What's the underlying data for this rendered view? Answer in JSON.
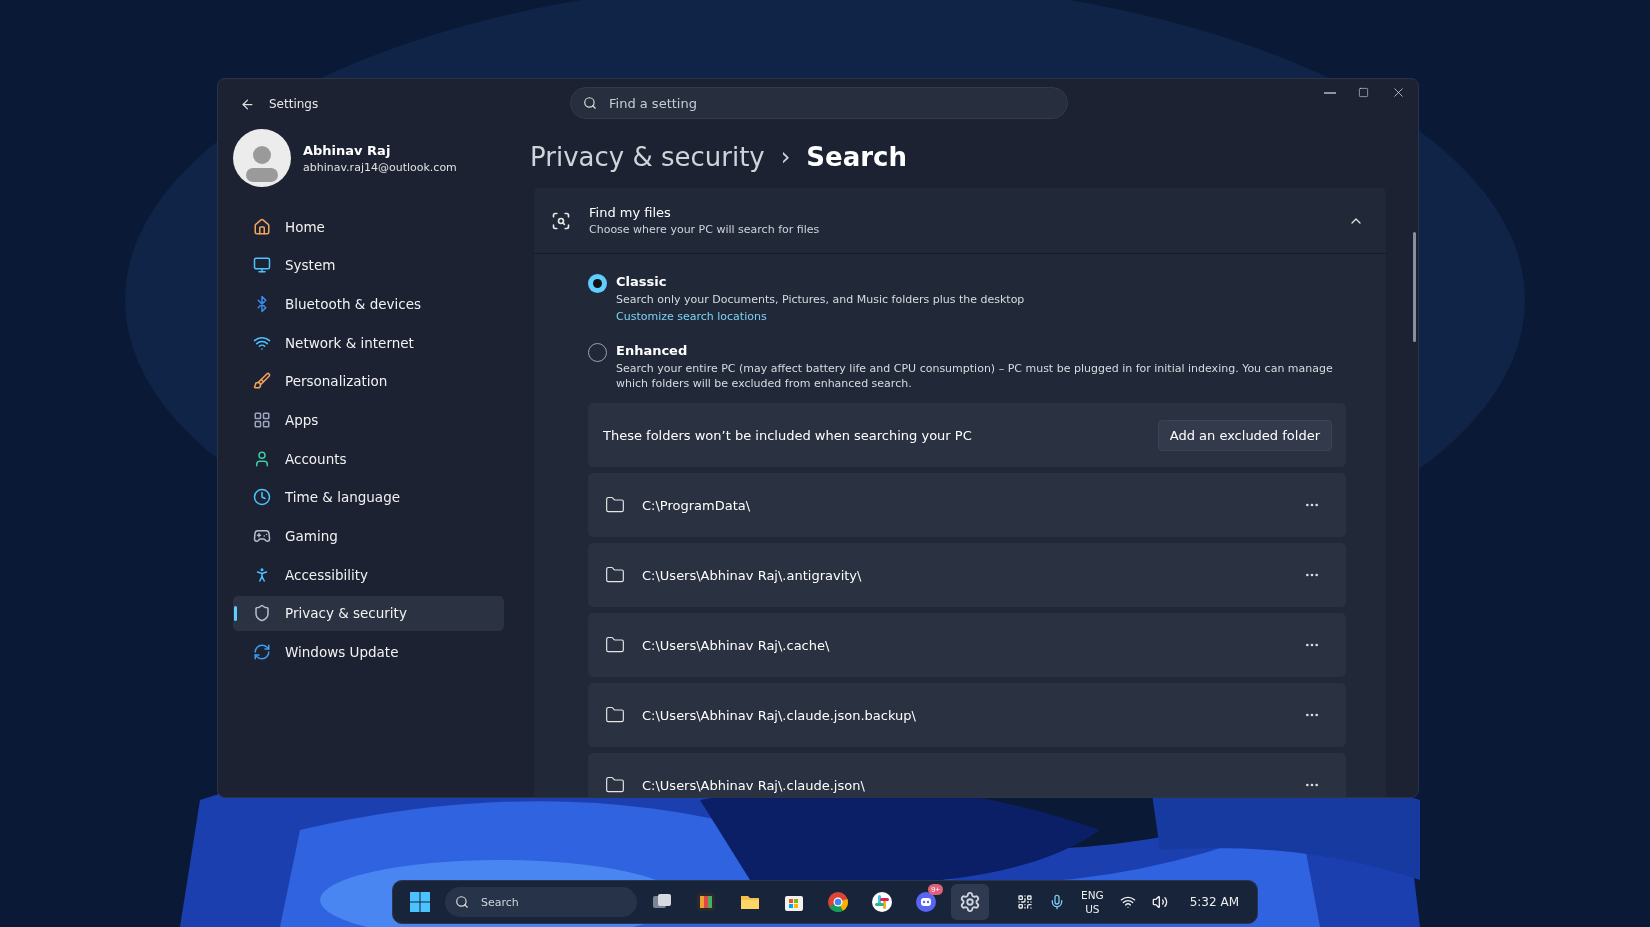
{
  "window": {
    "title": "Settings",
    "search_placeholder": "Find a setting"
  },
  "user": {
    "name": "Abhinav Raj",
    "email": "abhinav.raj14@outlook.com"
  },
  "sidebar": {
    "items": [
      {
        "label": "Home",
        "selected": false
      },
      {
        "label": "System",
        "selected": false
      },
      {
        "label": "Bluetooth & devices",
        "selected": false
      },
      {
        "label": "Network & internet",
        "selected": false
      },
      {
        "label": "Personalization",
        "selected": false
      },
      {
        "label": "Apps",
        "selected": false
      },
      {
        "label": "Accounts",
        "selected": false
      },
      {
        "label": "Time & language",
        "selected": false
      },
      {
        "label": "Gaming",
        "selected": false
      },
      {
        "label": "Accessibility",
        "selected": false
      },
      {
        "label": "Privacy & security",
        "selected": true
      },
      {
        "label": "Windows Update",
        "selected": false
      }
    ]
  },
  "breadcrumb": {
    "parent": "Privacy & security",
    "separator": "›",
    "current": "Search"
  },
  "section": {
    "title": "Find my files",
    "subtitle": "Choose where your PC will search for files",
    "expanded": true,
    "options": [
      {
        "label": "Classic",
        "description": "Search only your Documents, Pictures, and Music folders plus the desktop",
        "link": "Customize search locations",
        "selected": true
      },
      {
        "label": "Enhanced",
        "description": "Search your entire PC (may affect battery life and CPU consumption) – PC must be plugged in for initial indexing. You can manage which folders will be excluded from enhanced search.",
        "selected": false
      }
    ],
    "excluded": {
      "caption": "These folders won’t be included when searching your PC",
      "button": "Add an excluded folder",
      "folders": [
        "C:\\ProgramData\\",
        "C:\\Users\\Abhinav Raj\\.antigravity\\",
        "C:\\Users\\Abhinav Raj\\.cache\\",
        "C:\\Users\\Abhinav Raj\\.claude.json.backup\\",
        "C:\\Users\\Abhinav Raj\\.claude.json\\"
      ]
    }
  },
  "taskbar": {
    "search_placeholder": "Search",
    "apps": [
      {
        "kind": "taskview",
        "active": false
      },
      {
        "kind": "app",
        "active": false
      },
      {
        "kind": "explorer",
        "active": false
      },
      {
        "kind": "store",
        "active": false
      },
      {
        "kind": "chrome",
        "active": false
      },
      {
        "kind": "slack",
        "active": false
      },
      {
        "kind": "discord",
        "active": false,
        "badge": "9+"
      },
      {
        "kind": "settings",
        "active": true
      }
    ],
    "language": "ENG",
    "region": "US",
    "time": "5:32 AM"
  }
}
